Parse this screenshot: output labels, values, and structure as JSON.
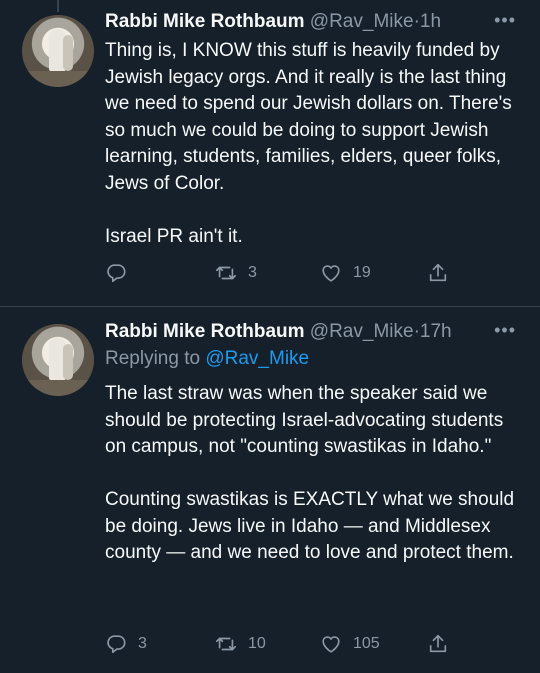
{
  "tweets": [
    {
      "author_name": "Rabbi Mike Rothbaum",
      "handle": "@Rav_Mike",
      "separator": "·",
      "time": "1h",
      "more": "•••",
      "body": "Thing is, I KNOW this stuff is heavily funded by Jewish legacy orgs. And it really is the last thing we need to spend our Jewish dollars on. There's so much we could be doing to support Jewish learning, students, families, elders, queer folks, Jews of Color.\n\nIsrael PR ain't it.",
      "replies": "",
      "retweets": "3",
      "likes": "19"
    },
    {
      "author_name": "Rabbi Mike Rothbaum",
      "handle": "@Rav_Mike",
      "separator": "·",
      "time": "17h",
      "more": "•••",
      "replying_prefix": "Replying to",
      "replying_to": "@Rav_Mike",
      "body": "The last straw was when the speaker said we should be protecting Israel-advocating students on campus, not \"counting swastikas in Idaho.\"\n\nCounting swastikas is EXACTLY what we should be doing.  Jews live in Idaho — and Middlesex county — and we need to love and protect them.",
      "replies": "3",
      "retweets": "10",
      "likes": "105"
    }
  ],
  "icons": {
    "reply": "reply-icon",
    "retweet": "retweet-icon",
    "like": "heart-icon",
    "share": "share-icon"
  },
  "colors": {
    "background": "#15202b",
    "text": "#f7f9f9",
    "muted": "#8b98a5",
    "link": "#1d9bf0",
    "divider": "#38444d"
  }
}
